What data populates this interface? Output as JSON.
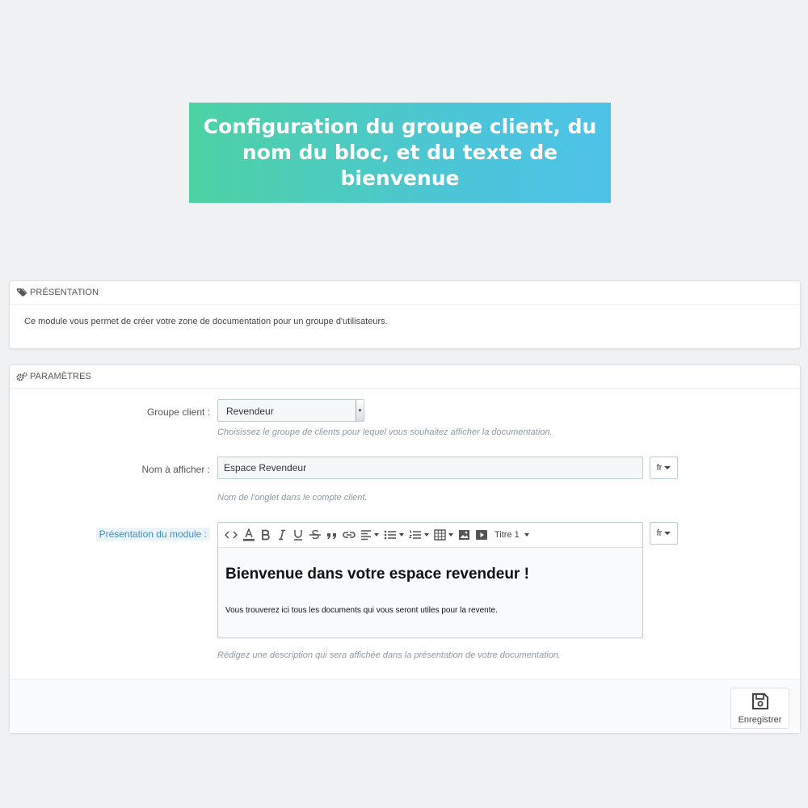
{
  "banner": {
    "title": "Configuration du groupe client, du nom du bloc, et du texte de bienvenue"
  },
  "presentation_panel": {
    "heading": "PRÉSENTATION",
    "heading_icon": "tags-icon",
    "text": "Ce module vous permet de créer votre zone de documentation pour un groupe d'utilisateurs."
  },
  "params_panel": {
    "heading": "PARAMÈTRES",
    "heading_icon": "cogs-icon",
    "group": {
      "label": "Groupe client :",
      "selected": "Revendeur",
      "help": "Choisissez le groupe de clients pour lequel vous souhaitez afficher la documentation."
    },
    "display_name": {
      "label": "Nom à afficher :",
      "value": "Espace Revendeur",
      "lang": "fr",
      "help": "Nom de l'onglet dans le compte client."
    },
    "module_presentation": {
      "label": "Présentation du module :",
      "lang": "fr",
      "toolbar": {
        "heading_select": "Titre 1",
        "buttons": [
          "code-icon",
          "font-color-icon",
          "bold-icon",
          "italic-icon",
          "underline-icon",
          "strikethrough-icon",
          "quote-icon",
          "link-icon",
          "align-left-icon",
          "bullet-list-icon",
          "numbered-list-icon",
          "table-icon",
          "image-icon",
          "video-icon"
        ]
      },
      "content_heading": "Bienvenue dans votre espace revendeur !",
      "content_text": "Vous trouverez ici tous les documents qui vous seront utiles pour la revente.",
      "help": "Rédigez une description qui sera affichée dans la présentation de votre documentation."
    },
    "save_label": "Enregistrer"
  }
}
